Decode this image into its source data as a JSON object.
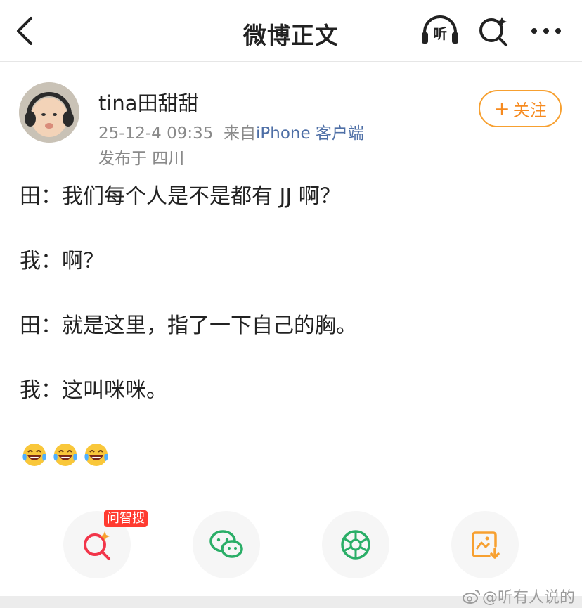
{
  "nav": {
    "title": "微博正文",
    "listen_label": "听",
    "icons": {
      "back": "back-arrow-icon",
      "listen": "headphones-icon",
      "search": "ai-search-icon",
      "more": "more-dots-icon"
    }
  },
  "author": {
    "name": "tina田甜甜",
    "timestamp": "25-12-4 09:35",
    "source_prefix": "来自",
    "source": "iPhone 客户端",
    "location": "发布于 四川",
    "follow_label": "关注",
    "follow_plus": "+"
  },
  "post": {
    "lines": [
      "田：我们每个人是不是都有 JJ 啊？",
      "我：啊？",
      "田：就是这里，指了一下自己的胸。",
      "我：这叫咪咪。"
    ],
    "emojis": [
      "laughing-tears-emoji",
      "laughing-tears-emoji",
      "laughing-tears-emoji"
    ]
  },
  "actions": {
    "ask_badge": "问智搜",
    "items": [
      "ai-search-icon",
      "wechat-icon",
      "moments-icon",
      "save-image-icon"
    ]
  },
  "watermark": "@听有人说的",
  "colors": {
    "accent": "#f68a1f",
    "link": "#4e6fa6",
    "badge": "#ff3b30",
    "wechat": "#2aae67"
  }
}
